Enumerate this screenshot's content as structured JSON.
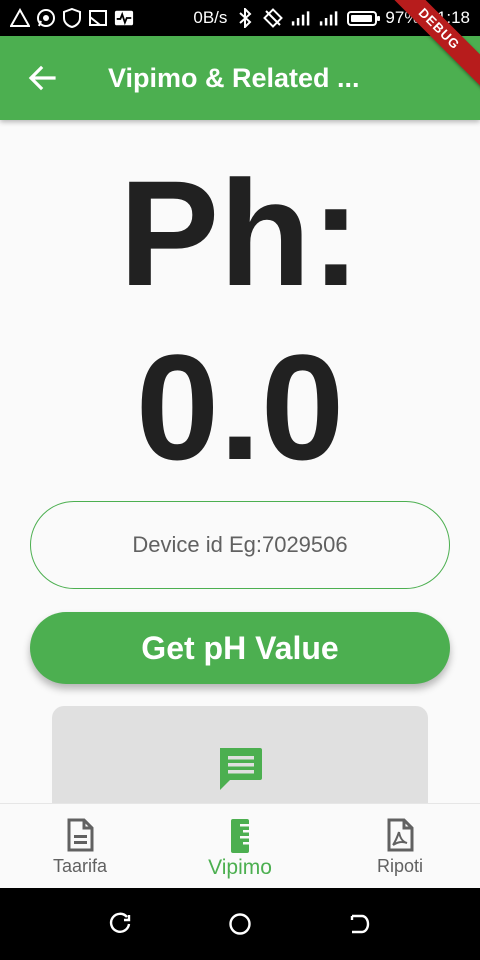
{
  "status_bar": {
    "net_speed": "0B/s",
    "battery_percent": "97%",
    "battery_level": 0.97,
    "time": "21:18",
    "icons": [
      "warning-icon",
      "whatsapp-icon",
      "shield-icon",
      "cast-icon",
      "activity-icon",
      "bluetooth-icon",
      "rotate-icon",
      "signal-icon",
      "signal-icon",
      "battery-icon"
    ]
  },
  "debug_banner": "DEBUG",
  "app_bar": {
    "title": "Vipimo & Related ...",
    "back_icon": "arrow-back-icon"
  },
  "reading": {
    "label": "Ph:",
    "value": "0.0"
  },
  "device_field": {
    "value": "",
    "placeholder": "Device id Eg:7029506"
  },
  "get_button": {
    "label": "Get pH Value"
  },
  "info_card": {
    "icon": "message-icon",
    "text": ""
  },
  "bottom_nav": {
    "items": [
      {
        "label": "Taarifa",
        "icon": "document-icon",
        "active": false
      },
      {
        "label": "Vipimo",
        "icon": "ruler-icon",
        "active": true
      },
      {
        "label": "Ripoti",
        "icon": "pdf-icon",
        "active": false
      }
    ]
  },
  "colors": {
    "primary": "#4caf50",
    "text_dark": "#212121",
    "text_muted": "#616161",
    "card_bg": "#e0e0e0",
    "debug": "#b71c1c"
  }
}
